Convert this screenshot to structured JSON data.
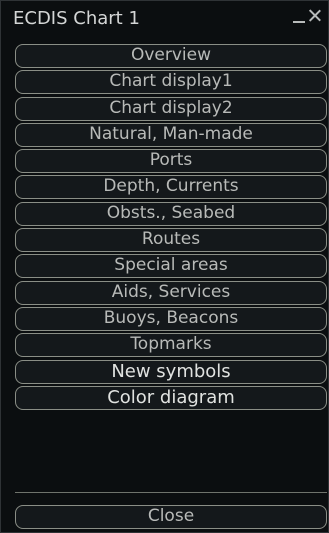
{
  "window": {
    "title": "ECDIS Chart 1",
    "minimize_glyph": "_",
    "close_glyph": "×"
  },
  "menu": {
    "items": [
      {
        "label": "Overview"
      },
      {
        "label": "Chart display1"
      },
      {
        "label": "Chart display2"
      },
      {
        "label": "Natural, Man-made"
      },
      {
        "label": "Ports"
      },
      {
        "label": "Depth, Currents"
      },
      {
        "label": "Obsts., Seabed"
      },
      {
        "label": "Routes"
      },
      {
        "label": "Special areas"
      },
      {
        "label": "Aids, Services"
      },
      {
        "label": "Buoys, Beacons"
      },
      {
        "label": "Topmarks"
      },
      {
        "label": "New symbols"
      },
      {
        "label": "Color diagram"
      }
    ]
  },
  "footer": {
    "close_label": "Close"
  },
  "colors": {
    "panel_bg": "#0b0e10",
    "button_bg": "#14181b",
    "button_border": "#8a8e86",
    "text": "#b8bab8"
  }
}
